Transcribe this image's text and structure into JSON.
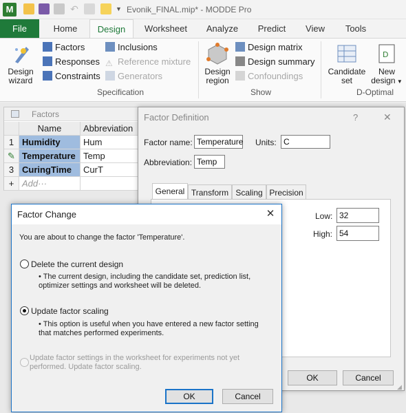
{
  "app": {
    "title": "Evonik_FINAL.mip* - MODDE Pro",
    "icon_letter": "M"
  },
  "menu": {
    "file": "File",
    "tabs": [
      "Home",
      "Design",
      "Worksheet",
      "Analyze",
      "Predict",
      "View",
      "Tools"
    ],
    "active_tab": "Design"
  },
  "ribbon": {
    "design_wizard": "Design\nwizard",
    "design_wizard_l1": "Design",
    "design_wizard_l2": "wizard",
    "factors": "Factors",
    "responses": "Responses",
    "constraints": "Constraints",
    "inclusions": "Inclusions",
    "reference_mixture": "Reference mixture",
    "generators": "Generators",
    "specification_group": "Specification",
    "design_region_l1": "Design",
    "design_region_l2": "region",
    "design_matrix": "Design matrix",
    "design_summary": "Design summary",
    "confoundings": "Confoundings",
    "show_group": "Show",
    "candidate_set_l1": "Candidate",
    "candidate_set_l2": "set",
    "new_design_l1": "New",
    "new_design_l2": "design",
    "doptimal_group": "D-Optimal"
  },
  "factors_grid": {
    "title": "Factors",
    "columns": [
      "Name",
      "Abbreviation"
    ],
    "rows": [
      {
        "num": "1",
        "name": "Humidity",
        "abbr": "Hum"
      },
      {
        "num": "",
        "name": "Temperature",
        "abbr": "Temp"
      },
      {
        "num": "3",
        "name": "CuringTime",
        "abbr": "CurT"
      }
    ],
    "add_row": {
      "num": "+",
      "label": "Add···"
    }
  },
  "factor_definition": {
    "title": "Factor Definition",
    "help": "?",
    "close": "✕",
    "factor_name_label": "Factor name:",
    "factor_name_value": "Temperature",
    "units_label": "Units:",
    "units_value": "C",
    "abbreviation_label": "Abbreviation:",
    "abbreviation_value": "Temp",
    "tabs": [
      "General",
      "Transform",
      "Scaling",
      "Precision"
    ],
    "active_tab": "General",
    "low_label": "Low:",
    "low_value": "32",
    "high_label": "High:",
    "high_value": "54",
    "ok": "OK",
    "cancel": "Cancel"
  },
  "factor_change": {
    "title": "Factor Change",
    "close": "✕",
    "message": "You are about to change the factor 'Temperature'.",
    "options": [
      {
        "label": "Delete the current design",
        "desc_line1": "• The current design, including the candidate set, prediction list,",
        "desc_line2": "optimizer settings and worksheet will be deleted.",
        "selected": false,
        "enabled": true
      },
      {
        "label": "Update factor scaling",
        "desc_line1": "• This option is useful when you have entered a new factor setting",
        "desc_line2": "that matches performed experiments.",
        "selected": true,
        "enabled": true
      },
      {
        "label_line1": "Update factor settings in the worksheet for experiments not yet",
        "label_line2": "performed. Update factor scaling.",
        "selected": false,
        "enabled": false
      }
    ],
    "ok": "OK",
    "cancel": "Cancel"
  },
  "colors": {
    "file_tab": "#1f7a3a",
    "selected_name_cell": "#9fbcdf",
    "dialog_border": "#1a73c8"
  }
}
